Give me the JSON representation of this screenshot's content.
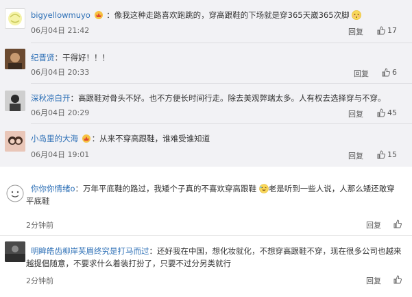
{
  "comments": [
    {
      "username": "bigyellowmuyo",
      "text": "：像我这种走路喜欢跑跳的，穿高跟鞋的下场就是穿365天崴365次脚",
      "timestamp": "06月04日 21:42",
      "reply": "回复",
      "likes": "17"
    },
    {
      "username": "纪晋贤",
      "text": "：干得好！！！",
      "timestamp": "06月04日 20:33",
      "reply": "回复",
      "likes": "6"
    },
    {
      "username": "深秋凉白开",
      "text": "：高跟鞋对骨头不好。也不方便长时间行走。除去美观弊端太多。人有权去选择穿与不穿。",
      "timestamp": "06月04日 20:29",
      "reply": "回复",
      "likes": "45"
    },
    {
      "username": "小岛里的大海",
      "text": "：从来不穿高跟鞋，谁难受谁知道",
      "timestamp": "06月04日 19:01",
      "reply": "回复",
      "likes": "15"
    }
  ],
  "bottom_comments": [
    {
      "username": "你你你情绪o",
      "text_part1": "：万年平底鞋的路过，我矮个子真的不喜欢穿高跟鞋",
      "text_part2": "老是听到一些人说，人那么矮还敢穿",
      "text_line2": "平底鞋",
      "timestamp": "2分钟前",
      "reply": "回复"
    },
    {
      "username": "明眸皓齿柳岸芙眉终究是打马而过",
      "text_line1": "：还好我在中国，想化妆就化，不想穿高跟鞋不穿，现在很多公司也越来",
      "text_line2": "越提倡随意，不要求什么着装打扮了，只要不过分另类就行",
      "timestamp": "2分钟前",
      "reply": "回复"
    }
  ]
}
